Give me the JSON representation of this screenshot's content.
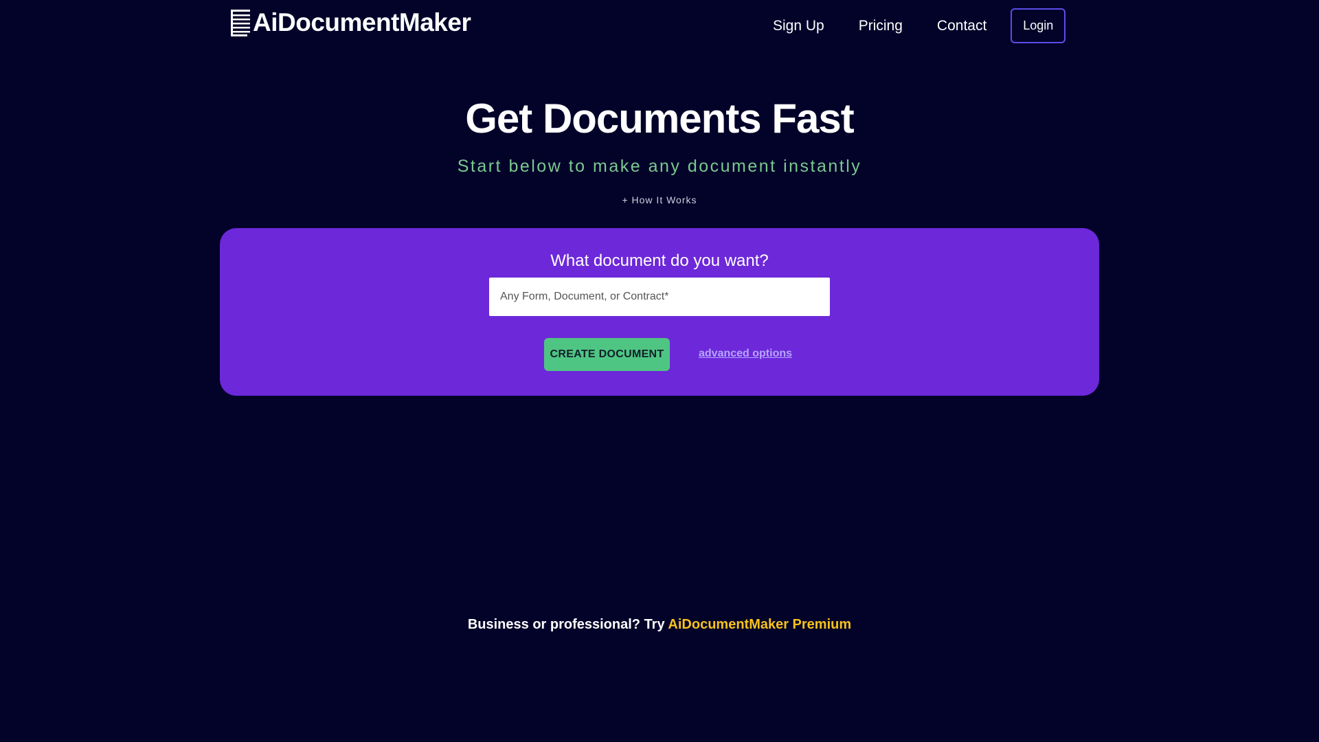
{
  "header": {
    "logo_text": "AiDocumentMaker",
    "nav": {
      "signup": "Sign Up",
      "pricing": "Pricing",
      "contact": "Contact",
      "login": "Login"
    }
  },
  "hero": {
    "title": "Get Documents Fast",
    "subtitle": "Start below to make any document instantly",
    "how_it_works": "+ How It Works"
  },
  "form": {
    "question": "What document do you want?",
    "input_value": "",
    "input_placeholder": "Any Form, Document, or Contract*",
    "create_button": "CREATE DOCUMENT",
    "advanced_options": "advanced options"
  },
  "promo": {
    "text": "Business or professional? Try ",
    "link": "AiDocumentMaker Premium"
  },
  "colors": {
    "background": "#03032a",
    "card": "#6d28d9",
    "subtitle": "#7cc98f",
    "button": "#4fc583",
    "premium_link": "#f7c21b",
    "login_border": "#5b4ee8"
  },
  "icons": {
    "logo": "document-lines-icon"
  }
}
